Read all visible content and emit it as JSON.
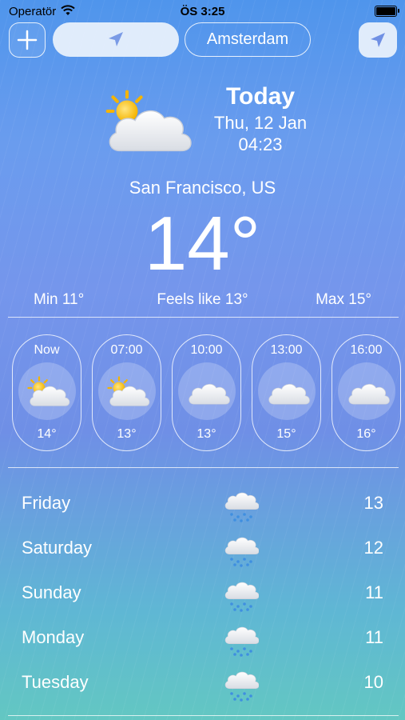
{
  "status_bar": {
    "carrier": "Operatör",
    "time": "ÖS 3:25"
  },
  "top_bar": {
    "city_tab": "Amsterdam"
  },
  "header": {
    "today_label": "Today",
    "date": "Thu, 12 Jan",
    "time": "04:23",
    "location": "San Francisco, US",
    "temperature": "14°",
    "min": "Min 11°",
    "feels_like": "Feels like 13°",
    "max": "Max 15°"
  },
  "hourly": [
    {
      "time": "Now",
      "temp": "14°",
      "icon": "partly-cloudy-icon"
    },
    {
      "time": "07:00",
      "temp": "13°",
      "icon": "partly-cloudy-icon"
    },
    {
      "time": "10:00",
      "temp": "13°",
      "icon": "cloud-icon"
    },
    {
      "time": "13:00",
      "temp": "15°",
      "icon": "cloud-icon"
    },
    {
      "time": "16:00",
      "temp": "16°",
      "icon": "cloud-icon"
    }
  ],
  "daily": [
    {
      "day": "Friday",
      "temp": "13",
      "icon": "rain-cloud-icon"
    },
    {
      "day": "Saturday",
      "temp": "12",
      "icon": "rain-cloud-icon"
    },
    {
      "day": "Sunday",
      "temp": "11",
      "icon": "rain-cloud-icon"
    },
    {
      "day": "Monday",
      "temp": "11",
      "icon": "rain-cloud-icon"
    },
    {
      "day": "Tuesday",
      "temp": "10",
      "icon": "rain-cloud-icon"
    }
  ]
}
